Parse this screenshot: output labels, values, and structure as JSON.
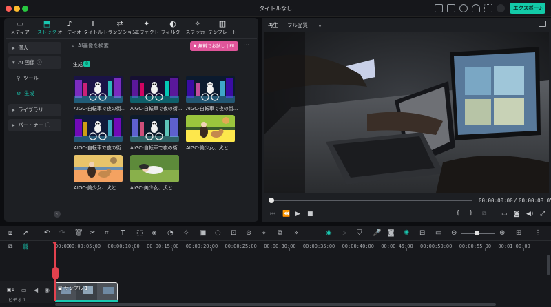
{
  "window": {
    "title": "タイトルなし",
    "export_label": "エクスポート"
  },
  "tabs": [
    {
      "label": "メディア",
      "icon": "media-icon"
    },
    {
      "label": "ストック",
      "icon": "stock-icon",
      "active": true
    },
    {
      "label": "オーディオ",
      "icon": "music-icon"
    },
    {
      "label": "タイトル",
      "icon": "title-icon"
    },
    {
      "label": "トランジション",
      "icon": "transition-icon"
    },
    {
      "label": "エフェクト",
      "icon": "effect-icon"
    },
    {
      "label": "フィルター",
      "icon": "filter-icon"
    },
    {
      "label": "ステッカー",
      "icon": "sticker-icon"
    },
    {
      "label": "テンプレート",
      "icon": "template-icon"
    }
  ],
  "sidebar": {
    "personal": "個人",
    "ai_image": "AI 画像",
    "tool": "ツール",
    "generate": "生成",
    "library": "ライブラリ",
    "partner": "パートナー"
  },
  "search": {
    "placeholder": "AI画像を検索",
    "trial": "無料でお試し | Fil"
  },
  "section": {
    "label": "生成",
    "badge": "8"
  },
  "thumbs": [
    {
      "label": "AIGC-自転車で夜の街..."
    },
    {
      "label": "AIGC-自転車で夜の街..."
    },
    {
      "label": "AIGC-自転車で夜の街..."
    },
    {
      "label": "AIGC-自転車で夜の街..."
    },
    {
      "label": "AIGC-自転車で夜の街..."
    },
    {
      "label": "AIGC-美少女、犬と..."
    },
    {
      "label": "AIGC-美少女、犬と..."
    },
    {
      "label": "AIGC-美少女、犬と..."
    }
  ],
  "player": {
    "tab": "再生",
    "quality": "フル品質",
    "current_time": "00:00:00:00",
    "separator": "/",
    "total_time": "00:00:08:05"
  },
  "timeline": {
    "ruler": [
      "00:00",
      "00:00:05:00",
      "00:00:10:00",
      "00:00:15:00",
      "00:00:20:00",
      "00:00:25:00",
      "00:00:30:00",
      "00:00:35:00",
      "00:00:40:00",
      "00:00:45:00",
      "00:00:50:00",
      "00:00:55:00",
      "00:01:00:00"
    ],
    "track_label": "ビデオ 1",
    "track_number": "1",
    "clip_label": "サンプル-1"
  },
  "colors": {
    "accent": "#13c7a5",
    "playhead": "#e3414e",
    "trial": "#e0559a"
  }
}
